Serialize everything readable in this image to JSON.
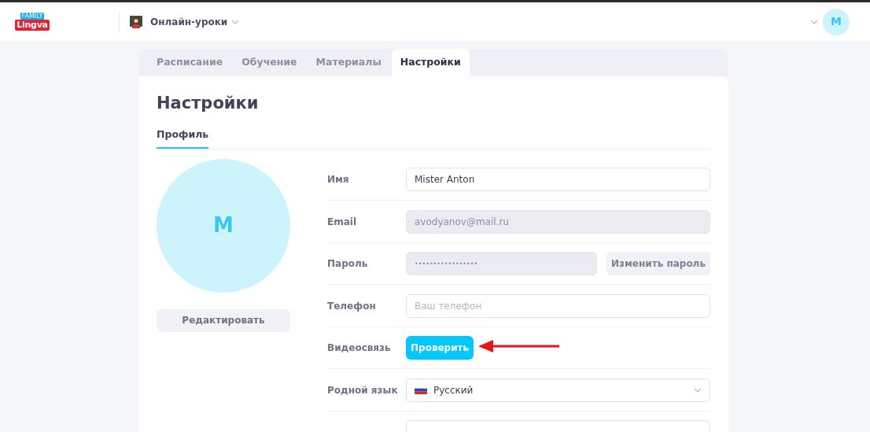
{
  "header": {
    "logo": {
      "badge": "FAMILY",
      "word": "Lingva"
    },
    "product": "Онлайн-уроки",
    "avatar": "M"
  },
  "tabs": [
    {
      "label": "Расписание",
      "selected": false
    },
    {
      "label": "Обучение",
      "selected": false
    },
    {
      "label": "Материалы",
      "selected": false
    },
    {
      "label": "Настройки",
      "selected": true
    }
  ],
  "page": {
    "title": "Настройки",
    "subtabs": [
      {
        "label": "Профиль",
        "selected": true
      }
    ],
    "avatar": "M",
    "edit_button": "Редактировать",
    "fields": [
      {
        "kind": "input",
        "label": "Имя",
        "value": "Mister Anton"
      },
      {
        "kind": "readonly",
        "label": "Email",
        "value": "avodyanov@mail.ru"
      },
      {
        "kind": "password",
        "label": "Пароль",
        "value": "•••••••••••••••••",
        "action": "Изменить пароль"
      },
      {
        "kind": "input",
        "label": "Телефон",
        "placeholder": "Ваш телефон"
      },
      {
        "kind": "button",
        "label": "Видеосвязь",
        "action": "Проверить"
      },
      {
        "kind": "select",
        "label": "Родной язык",
        "value": "Русский"
      },
      {
        "kind": "cut"
      }
    ]
  }
}
